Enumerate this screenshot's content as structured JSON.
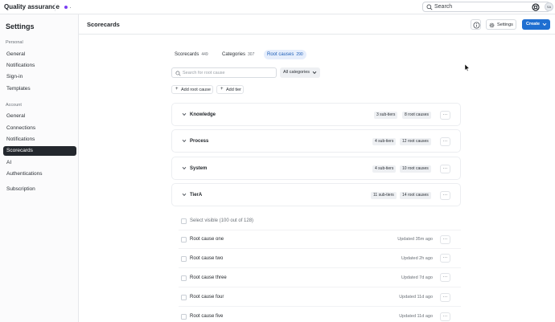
{
  "topbar": {
    "app_title": "Quality assurance",
    "search_label": "Search",
    "avatar_initials": "SA"
  },
  "sidebar": {
    "title": "Settings",
    "sections": [
      {
        "label": "Personal",
        "items": [
          "General",
          "Notifications",
          "Sign-in",
          "Templates"
        ]
      },
      {
        "label": "Account",
        "items": [
          "General",
          "Connections",
          "Notifications",
          "Scorecards",
          "AI",
          "Authentications"
        ]
      }
    ],
    "extra_item": "Subscription",
    "active_item": "Scorecards"
  },
  "header": {
    "page_title": "Scorecards",
    "settings_label": "Settings",
    "create_label": "Create"
  },
  "tabs": [
    {
      "label": "Scorecards",
      "count": "449"
    },
    {
      "label": "Categories",
      "count": "307"
    },
    {
      "label": "Root causes",
      "count": "290",
      "active": true
    }
  ],
  "toolbar": {
    "search_placeholder": "Search for root cause",
    "filter_label": "All categories",
    "add_root_cause_label": "Add root cause",
    "add_tier_label": "Add tier"
  },
  "tiers": [
    {
      "name": "Knowledge",
      "sub_tiers": "3 sub-tiers",
      "root_causes": "8 root causes"
    },
    {
      "name": "Process",
      "sub_tiers": "4 sub-tiers",
      "root_causes": "12 root causes"
    },
    {
      "name": "System",
      "sub_tiers": "4 sub-tiers",
      "root_causes": "10 root causes"
    },
    {
      "name": "TierA",
      "sub_tiers": "11 sub-tiers",
      "root_causes": "14 root causes"
    }
  ],
  "list": {
    "select_visible_label": "Select visible (100 out of 128)",
    "rows": [
      {
        "label": "Root cause one",
        "updated": "Updated 35m ago"
      },
      {
        "label": "Root cause two",
        "updated": "Updated 2h ago"
      },
      {
        "label": "Root cause three",
        "updated": "Updated 7d ago"
      },
      {
        "label": "Root cause four",
        "updated": "Updated 11d ago"
      },
      {
        "label": "Root cause five",
        "updated": "Updated 11d ago"
      }
    ]
  },
  "icons": {
    "search": "search-icon",
    "help": "help-icon",
    "info": "info-icon",
    "gear": "gear-icon",
    "chevron_down": "chevron-down-icon",
    "chevron_right": "chevron-right-icon",
    "more": "more-icon",
    "plus": "plus-icon",
    "cursor": "cursor-icon"
  },
  "colors": {
    "accent": "#1f6fd1",
    "active_tab_bg": "#e6eefc",
    "sidebar_active_bg": "#23272d",
    "workspace_dot": "#7a3ff2"
  }
}
